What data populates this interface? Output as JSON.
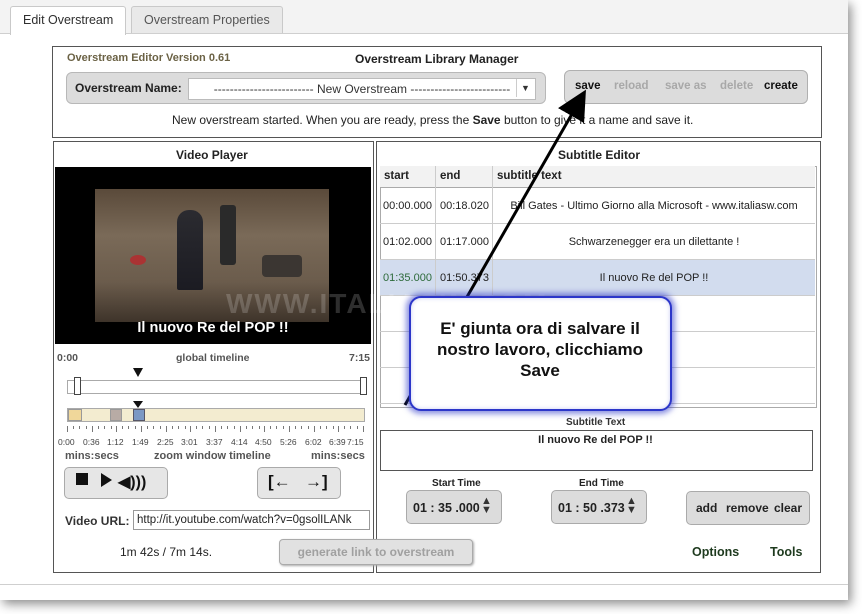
{
  "tabs": [
    {
      "label": "Edit Overstream",
      "active": true
    },
    {
      "label": "Overstream Properties",
      "active": false
    }
  ],
  "library": {
    "version": "Overstream Editor Version 0.61",
    "title": "Overstream Library Manager",
    "name_label": "Overstream Name:",
    "name_value": "------------------------- New Overstream -------------------------",
    "buttons": {
      "save": "save",
      "reload": "reload",
      "save_as": "save as",
      "delete": "delete",
      "create": "create"
    },
    "message_before": "New overstream started. When you are ready, press the ",
    "message_bold": "Save",
    "message_after": " button to give it a name and save it."
  },
  "video_player": {
    "title": "Video Player",
    "caption": "Il nuovo Re del POP !!",
    "timeline_start": "0:00",
    "timeline_label": "global timeline",
    "timeline_end": "7:15",
    "tick_labels": [
      "0:00",
      "0:36",
      "1:12",
      "1:49",
      "2:25",
      "3:01",
      "3:37",
      "4:14",
      "4:50",
      "5:26",
      "6:02",
      "6:39",
      "7:15"
    ],
    "units_left": "mins:secs",
    "zoom_label": "zoom window timeline",
    "units_right": "mins:secs",
    "url_label": "Video URL:",
    "url_value": "http://it.youtube.com/watch?v=0gsolILANk",
    "duration": "1m 42s / 7m 14s."
  },
  "generate_button": "generate link to overstream",
  "subtitle_editor": {
    "title": "Subtitle Editor",
    "columns": {
      "start": "start",
      "end": "end",
      "text": "subtitle text"
    },
    "rows": [
      {
        "start": "00:00.000",
        "end": "00:18.020",
        "text": "Bill Gates - Ultimo Giorno alla Microsoft - www.italiasw.com",
        "selected": false
      },
      {
        "start": "01:02.000",
        "end": "01:17.000",
        "text": "Schwarzenegger era un dilettante !",
        "selected": false
      },
      {
        "start": "01:35.000",
        "end": "01:50.373",
        "text": "Il nuovo Re del POP !!",
        "selected": true
      }
    ],
    "subtitle_text_label": "Subtitle Text",
    "subtitle_text_value": "Il nuovo Re del POP !!",
    "start_time_label": "Start Time",
    "start_time_value": "01 : 35 .000",
    "end_time_label": "End Time",
    "end_time_value": "01 : 50 .373",
    "add_label": "add",
    "remove_label": "remove",
    "clear_label": "clear",
    "options_label": "Options",
    "tools_label": "Tools"
  },
  "watermark": "WWW.ITALIASW.COM",
  "callout": {
    "line1": "E' giunta ora di salvare il",
    "line2": "nostro lavoro, clicchiamo",
    "line3": "Save",
    "border_color": "#2c36c9"
  },
  "icons": {
    "stop": "stop-icon",
    "play": "play-icon",
    "volume": "volume-icon",
    "set_start": "set-start-icon",
    "set_end": "set-end-icon",
    "select": "chevron-down-icon"
  }
}
